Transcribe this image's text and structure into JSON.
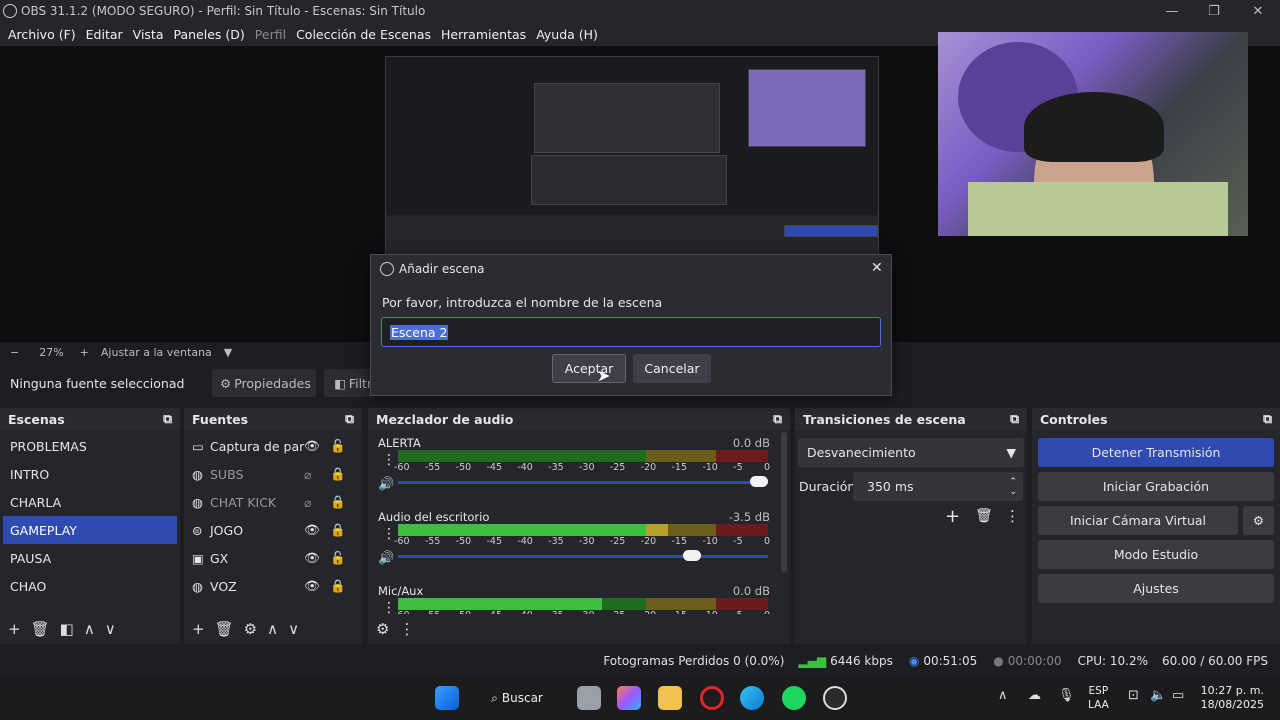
{
  "window": {
    "title": "OBS 31.1.2 (MODO SEGURO) - Perfil: Sin Título - Escenas: Sin Título"
  },
  "menu": [
    "Archivo (F)",
    "Editar",
    "Vista",
    "Paneles (D)",
    "Perfil",
    "Colección de Escenas",
    "Herramientas",
    "Ayuda (H)"
  ],
  "zoom": {
    "value": "27%",
    "fit_label": "Ajustar a la ventana"
  },
  "source_bar": {
    "no_source": "Ninguna fuente seleccionad",
    "properties": "Propiedades",
    "filters": "Filtr"
  },
  "scenes": {
    "title": "Escenas",
    "items": [
      "PROBLEMAS",
      "INTRO",
      "CHARLA",
      "GAMEPLAY",
      "PAUSA",
      "CHAO"
    ],
    "selected": "GAMEPLAY"
  },
  "sources": {
    "title": "Fuentes",
    "items": [
      {
        "label": "Captura de par",
        "visible": true
      },
      {
        "label": "SUBS",
        "visible": false
      },
      {
        "label": "CHAT KICK",
        "visible": false
      },
      {
        "label": "JOGO",
        "visible": true
      },
      {
        "label": "GX",
        "visible": true
      },
      {
        "label": "VOZ",
        "visible": true
      }
    ]
  },
  "mixer": {
    "title": "Mezclador de audio",
    "channels": [
      {
        "name": "ALERTA",
        "db": "0.0 dB",
        "level": 0,
        "volume": 1.0
      },
      {
        "name": "Audio del escritorio",
        "db": "-3.5 dB",
        "level": 0.73,
        "volume": 0.82
      },
      {
        "name": "Mic/Aux",
        "db": "0.0 dB",
        "level": 0.55,
        "volume": 1.0
      }
    ],
    "scale": [
      "-60",
      "-55",
      "-50",
      "-45",
      "-40",
      "-35",
      "-30",
      "-25",
      "-20",
      "-15",
      "-10",
      "-5",
      "0"
    ]
  },
  "transitions": {
    "title": "Transiciones de escena",
    "selected": "Desvanecimiento",
    "duration_label": "Duración",
    "duration_value": "350 ms"
  },
  "controls": {
    "title": "Controles",
    "stop_stream": "Detener Transmisión",
    "start_record": "Iniciar Grabación",
    "virtual_cam": "Iniciar Cámara Virtual",
    "studio_mode": "Modo Estudio",
    "settings": "Ajustes"
  },
  "dialog": {
    "title": "Añadir escena",
    "prompt": "Por favor, introduzca el nombre de la escena",
    "input_value": "Escena 2",
    "ok": "Aceptar",
    "cancel": "Cancelar"
  },
  "status": {
    "dropped": "Fotogramas Perdidos 0 (0.0%)",
    "bitrate": "6446 kbps",
    "stream_time": "00:51:05",
    "rec_time": "00:00:00",
    "cpu": "CPU: 10.2%",
    "fps": "60.00 / 60.00 FPS"
  },
  "taskbar": {
    "search": "Buscar",
    "lang_top": "ESP",
    "lang_bottom": "LAA",
    "time": "10:27 p. m.",
    "date": "18/08/2025"
  },
  "colors": {
    "accent": "#2f4ab0",
    "meter_green": "#3fbf3f",
    "meter_yellow": "#b5a12a",
    "meter_red": "#c0262e"
  }
}
